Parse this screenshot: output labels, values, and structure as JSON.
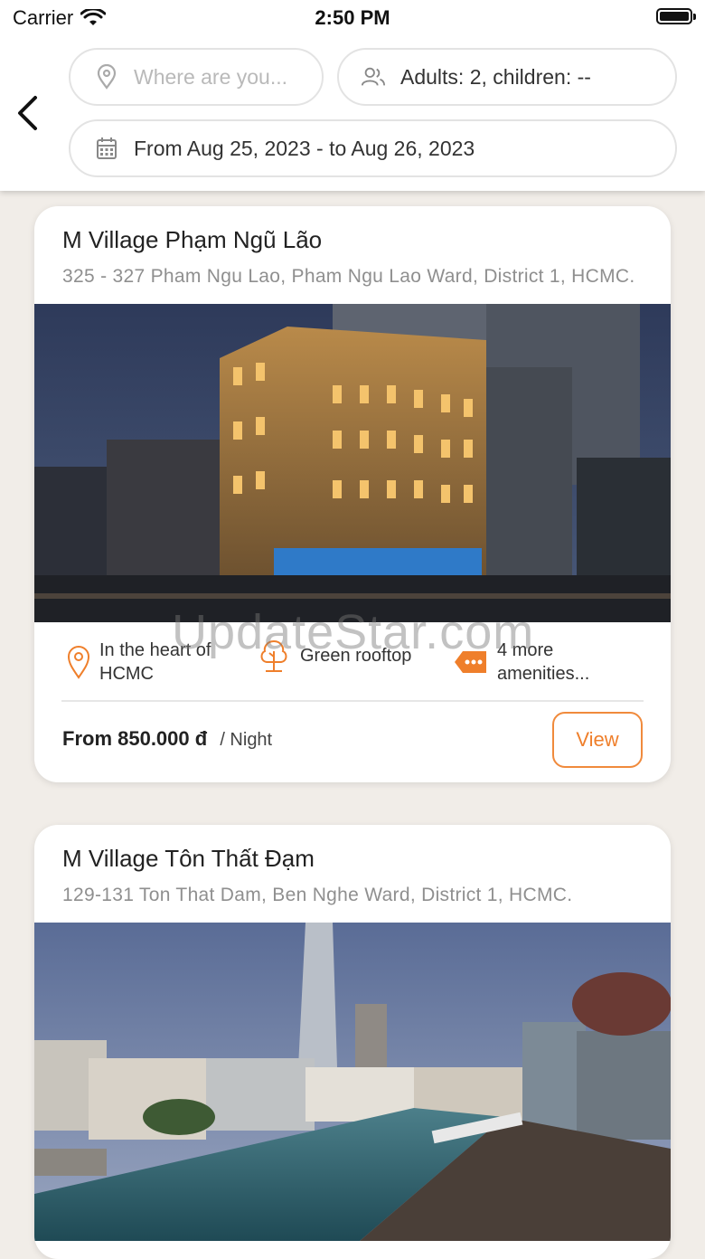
{
  "status_bar": {
    "carrier": "Carrier",
    "time": "2:50 PM"
  },
  "search": {
    "where_placeholder": "Where are you...",
    "guests": "Adults: 2, children: --",
    "dates": "From Aug 25, 2023 - to Aug 26, 2023"
  },
  "hotels": [
    {
      "name": "M Village Phạm Ngũ Lão",
      "address": "325 - 327 Pham Ngu Lao, Pham Ngu Lao Ward, District 1, HCMC.",
      "amenities": [
        "In the heart of HCMC",
        "Green rooftop",
        "4 more amenities..."
      ],
      "price": "From 850.000 đ",
      "price_unit": "/ Night",
      "view_label": "View"
    },
    {
      "name": "M Village Tôn Thất Đạm",
      "address": "129-131 Ton That Dam, Ben Nghe Ward, District 1, HCMC."
    }
  ],
  "watermark": "UpdateStar.com",
  "colors": {
    "accent": "#ef7f2b",
    "background": "#f1ede8"
  }
}
